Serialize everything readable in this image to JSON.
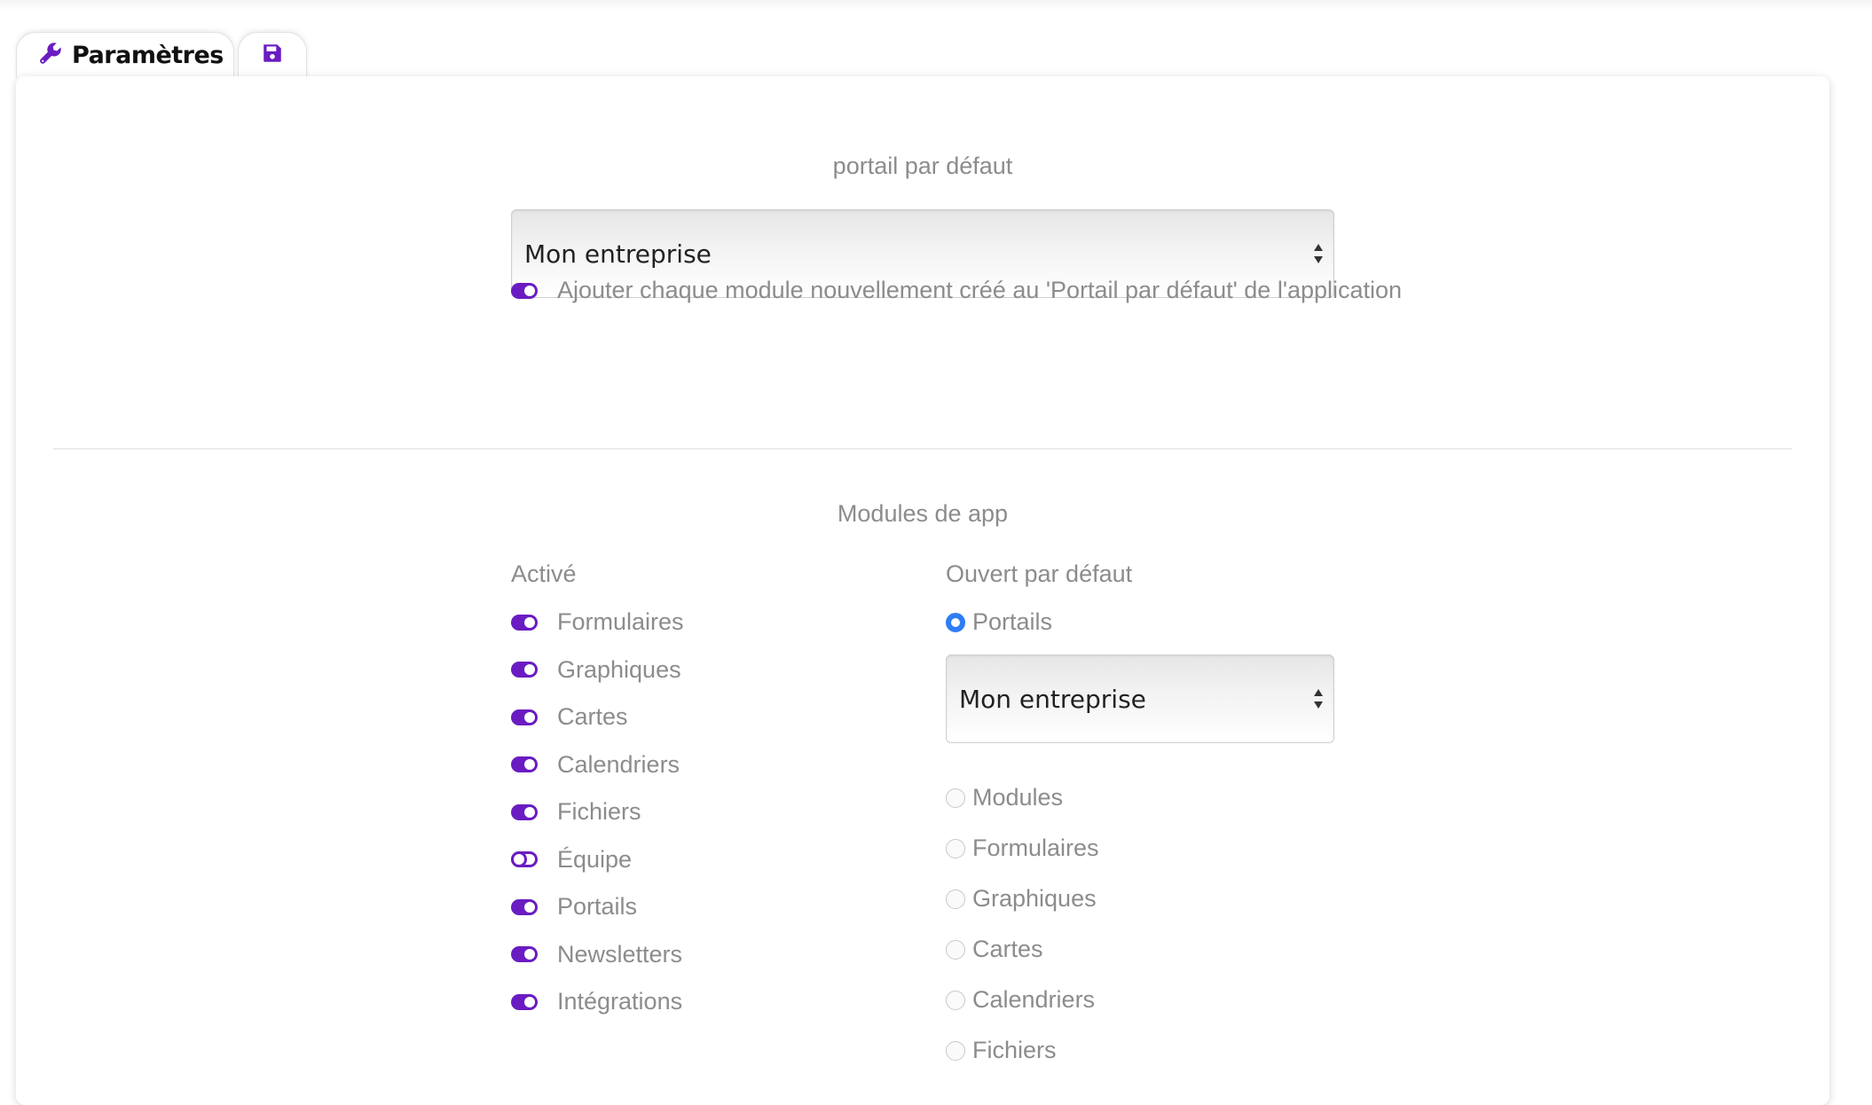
{
  "tabs": {
    "settings_label": "Paramètres",
    "settings_icon": "wrench-icon",
    "save_icon": "floppy-disk-icon"
  },
  "colors": {
    "accent_purple": "#6a1cc2",
    "radio_blue": "#2f7cf5",
    "muted_text": "#8c8c8c"
  },
  "default_portal": {
    "title": "portail par défaut",
    "select_value": "Mon entreprise",
    "add_module_toggle": {
      "label": "Ajouter chaque module nouvellement créé au 'Portail par défaut' de l'application",
      "on": true
    }
  },
  "app_modules": {
    "title": "Modules de app",
    "active_header": "Activé",
    "open_default_header": "Ouvert par défaut",
    "active_items": [
      {
        "label": "Formulaires",
        "on": true
      },
      {
        "label": "Graphiques",
        "on": true
      },
      {
        "label": "Cartes",
        "on": true
      },
      {
        "label": "Calendriers",
        "on": true
      },
      {
        "label": "Fichiers",
        "on": true
      },
      {
        "label": "Équipe",
        "on": false
      },
      {
        "label": "Portails",
        "on": true
      },
      {
        "label": "Newsletters",
        "on": true
      },
      {
        "label": "Intégrations",
        "on": true
      }
    ],
    "open_default_portals_label": "Portails",
    "open_default_portals_checked": true,
    "open_default_select_value": "Mon entreprise",
    "open_default_options": [
      {
        "label": "Modules",
        "checked": false
      },
      {
        "label": "Formulaires",
        "checked": false
      },
      {
        "label": "Graphiques",
        "checked": false
      },
      {
        "label": "Cartes",
        "checked": false
      },
      {
        "label": "Calendriers",
        "checked": false
      },
      {
        "label": "Fichiers",
        "checked": false
      }
    ]
  }
}
